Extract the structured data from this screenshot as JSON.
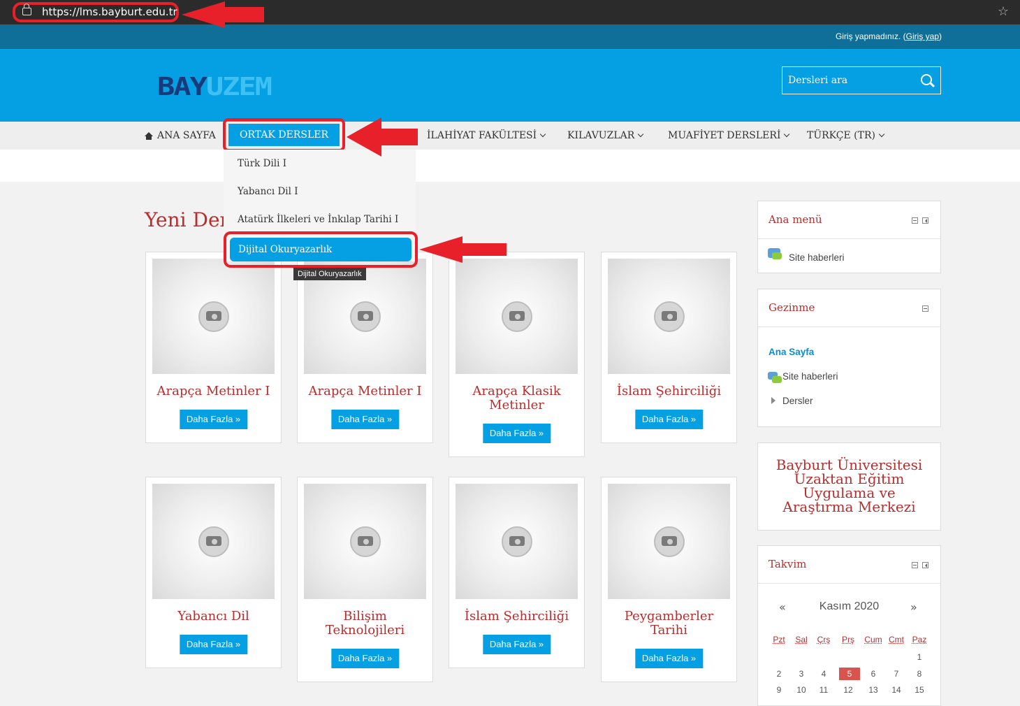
{
  "browser": {
    "url": "https://lms.bayburt.edu.tr"
  },
  "topbar": {
    "login_text": "Giriş yapmadınız.",
    "login_link": "Giriş yap"
  },
  "header": {
    "logo_a": "BAY",
    "logo_b": "UZEM",
    "search_placeholder": "Dersleri ara"
  },
  "nav": {
    "home": "ANA SAYFA",
    "ortak": "ORTAK DERSLER",
    "ilahiyat": "İLAHİYAT FAKÜLTESİ",
    "kilavuzlar": "KILAVUZLAR",
    "muafiyet": "MUAFİYET DERSLERİ",
    "lang": "TÜRKÇE (TR)"
  },
  "dropdown": {
    "items": [
      "Türk Dili I",
      "Yabancı Dil I",
      "Atatürk İlkeleri ve İnkılap Tarihi I",
      "Dijital Okuryazarlık"
    ],
    "tooltip": "Dijital Okuryazarlık"
  },
  "main": {
    "heading": "Yeni Der",
    "button_label": "Daha Fazla »",
    "courses": [
      {
        "title": "Arapça Metinler I"
      },
      {
        "title": "Arapça Metinler I"
      },
      {
        "title": "Arapça Klasik Metinler"
      },
      {
        "title": "İslam Şehirciliği"
      },
      {
        "title": "Yabancı Dil"
      },
      {
        "title": "Bilişim Teknolojileri"
      },
      {
        "title": "İslam Şehirciliği"
      },
      {
        "title": "Peygamberler Tarihi"
      }
    ]
  },
  "sidebar": {
    "main_menu": {
      "title": "Ana menü",
      "item": "Site haberleri"
    },
    "nav": {
      "title": "Gezinme",
      "home": "Ana Sayfa",
      "news": "Site haberleri",
      "courses": "Dersler"
    },
    "uni": {
      "text": "Bayburt Üniversitesi Uzaktan Eğitim Uygulama ve Araştırma Merkezi"
    },
    "calendar": {
      "title": "Takvim",
      "prev": "«",
      "month": "Kasım 2020",
      "next": "»",
      "days": [
        "Pzt",
        "Sal",
        "Çrş",
        "Prş",
        "Cum",
        "Cmt",
        "Paz"
      ],
      "row1": [
        "",
        "",
        "",
        "",
        "",
        "",
        "1"
      ],
      "row2": [
        "2",
        "3",
        "4",
        "5",
        "6",
        "7",
        "8"
      ],
      "row3": [
        "9",
        "10",
        "11",
        "12",
        "13",
        "14",
        "15"
      ],
      "today": "5"
    }
  },
  "colors": {
    "header_blue": "#059fe3",
    "strip_blue": "#0f6f98",
    "accent_red": "#b72e2e",
    "annotation_red": "#e8202a"
  }
}
